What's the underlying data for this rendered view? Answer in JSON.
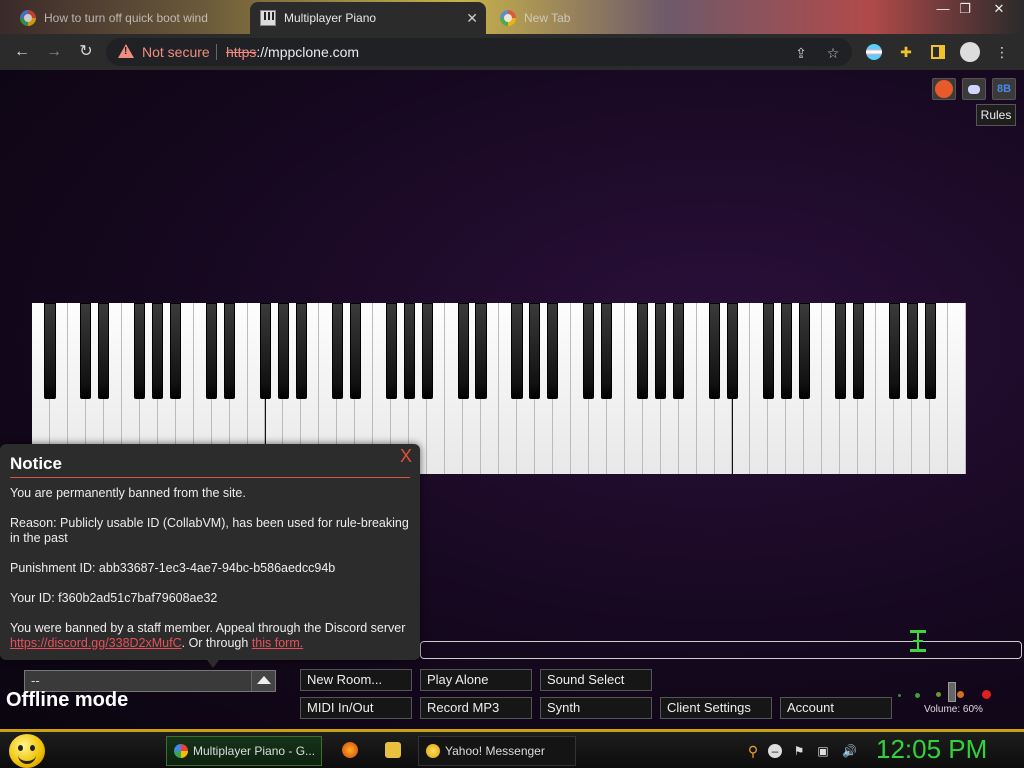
{
  "browser": {
    "tabs": [
      {
        "title": "How to turn off quick boot wind",
        "active": false
      },
      {
        "title": "Multiplayer Piano",
        "active": true
      },
      {
        "title": "New Tab",
        "active": false
      }
    ],
    "window_controls": {
      "minimize": "—",
      "restore": "❐",
      "close": "✕"
    },
    "security_label": "Not secure",
    "url_scheme": "https",
    "url_rest": "://mppclone.com"
  },
  "page": {
    "social": {
      "reddit_label": "",
      "discord_label": "",
      "hub_label": "8B"
    },
    "rules_label": "Rules",
    "notice": {
      "title": "Notice",
      "close_label": "X",
      "line1": "You are permanently banned from the site.",
      "line2": "Reason: Publicly usable ID (CollabVM), has been used for rule-breaking in the past",
      "line3": "Punishment ID: abb33687-1ec3-4ae7-94bc-b586aedcc94b",
      "line4": "Your ID: f360b2ad51c7baf79608ae32",
      "line5_prefix": "You were banned by a staff member. Appeal through the Discord server ",
      "line5_link": "https://discord.gg/338D2xMufC",
      "line5_middle": ". Or through ",
      "line5_form_link": "this form."
    },
    "room_select_value": "--",
    "offline_label": "Offline mode",
    "buttons": {
      "new_room": "New Room...",
      "play_alone": "Play Alone",
      "sound_select": "Sound Select",
      "midi": "MIDI In/Out",
      "record_mp3": "Record MP3",
      "synth": "Synth",
      "client_settings": "Client Settings",
      "account": "Account"
    },
    "volume_label": "Volume: 60%",
    "volume_level": 0.6
  },
  "taskbar": {
    "items": [
      {
        "label": "Multiplayer Piano - G..."
      },
      {
        "label": "Yahoo! Messenger"
      }
    ],
    "clock": "12:05 PM"
  },
  "colors": {
    "accent_orange": "#d0583e",
    "link_red": "#e8505a",
    "clock_green": "#2fd33a",
    "taskbar_gold": "#c9a214"
  }
}
